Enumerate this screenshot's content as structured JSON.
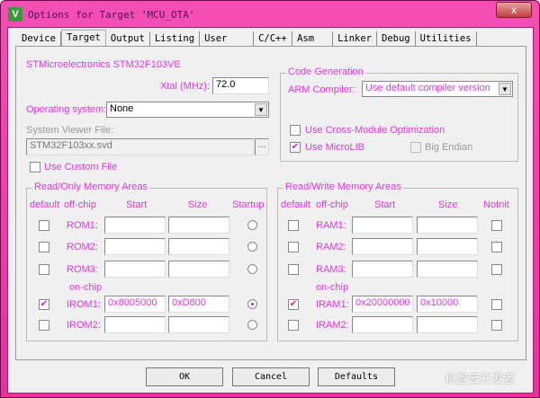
{
  "window": {
    "title": "Options for Target 'MCU_OTA'",
    "close": "x"
  },
  "tabs": [
    "Device",
    "Target",
    "Output",
    "Listing",
    "User",
    "C/C++",
    "Asm",
    "Linker",
    "Debug",
    "Utilities"
  ],
  "target": {
    "device": "STMicroelectronics STM32F103VE",
    "xtal_label": "Xtal (MHz):",
    "xtal_value": "72.0",
    "os_label": "Operating system:",
    "os_value": "None",
    "svf_label": "System Viewer File:",
    "svf_value": "STM32F103xx.svd",
    "browse": "...",
    "custom_file": "Use Custom File"
  },
  "codegen": {
    "title": "Code Generation",
    "compiler_label": "ARM Compiler:",
    "compiler_value": "Use default compiler version",
    "cross_module": "Use Cross-Module Optimization",
    "microlib": "Use MicroLIB",
    "big_endian": "Big Endian"
  },
  "rom": {
    "title": "Read/Only Memory Areas",
    "headers": [
      "default",
      "off-chip",
      "Start",
      "Size",
      "Startup"
    ],
    "onchip": "on-chip",
    "rows": [
      {
        "label": "ROM1:",
        "start": "",
        "size": ""
      },
      {
        "label": "ROM2:",
        "start": "",
        "size": ""
      },
      {
        "label": "ROM3:",
        "start": "",
        "size": ""
      },
      {
        "label": "IROM1:",
        "start": "0x8005000",
        "size": "0xD800"
      },
      {
        "label": "IROM2:",
        "start": "",
        "size": ""
      }
    ]
  },
  "ram": {
    "title": "Read/Write Memory Areas",
    "headers": [
      "default",
      "off-chip",
      "Start",
      "Size",
      "NoInit"
    ],
    "onchip": "on-chip",
    "rows": [
      {
        "label": "RAM1:",
        "start": "",
        "size": ""
      },
      {
        "label": "RAM2:",
        "start": "",
        "size": ""
      },
      {
        "label": "RAM3:",
        "start": "",
        "size": ""
      },
      {
        "label": "IRAM1:",
        "start": "0x20000000",
        "size": "0x10000"
      },
      {
        "label": "IRAM2:",
        "start": "",
        "size": ""
      }
    ]
  },
  "buttons": {
    "ok": "OK",
    "cancel": "Cancel",
    "defaults": "Defaults"
  },
  "watermark": "机智云开发者"
}
